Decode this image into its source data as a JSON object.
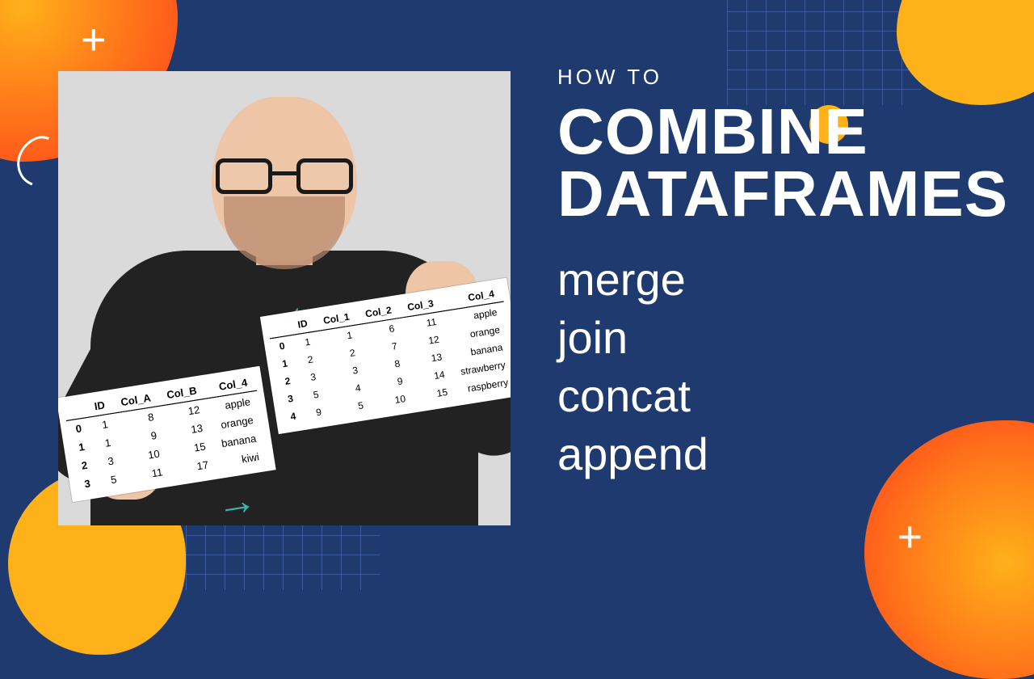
{
  "kicker": "HOW TO",
  "title_line1": "COMBINE",
  "title_line2": "DATAFRAMES",
  "methods": [
    "merge",
    "join",
    "concat",
    "append"
  ],
  "df_left": {
    "headers": [
      "",
      "ID",
      "Col_A",
      "Col_B",
      "Col_4"
    ],
    "rows": [
      [
        "0",
        "1",
        "8",
        "12",
        "apple"
      ],
      [
        "1",
        "1",
        "9",
        "13",
        "orange"
      ],
      [
        "2",
        "3",
        "10",
        "15",
        "banana"
      ],
      [
        "3",
        "5",
        "11",
        "17",
        "kiwi"
      ]
    ]
  },
  "df_right": {
    "headers": [
      "",
      "ID",
      "Col_1",
      "Col_2",
      "Col_3",
      "Col_4"
    ],
    "rows": [
      [
        "0",
        "1",
        "1",
        "6",
        "11",
        "apple"
      ],
      [
        "1",
        "2",
        "2",
        "7",
        "12",
        "orange"
      ],
      [
        "2",
        "3",
        "3",
        "8",
        "13",
        "banana"
      ],
      [
        "3",
        "5",
        "4",
        "9",
        "14",
        "strawberry"
      ],
      [
        "4",
        "9",
        "5",
        "10",
        "15",
        "raspberry"
      ]
    ]
  },
  "arrows": {
    "left": "←",
    "right": "→"
  },
  "plus": "+"
}
